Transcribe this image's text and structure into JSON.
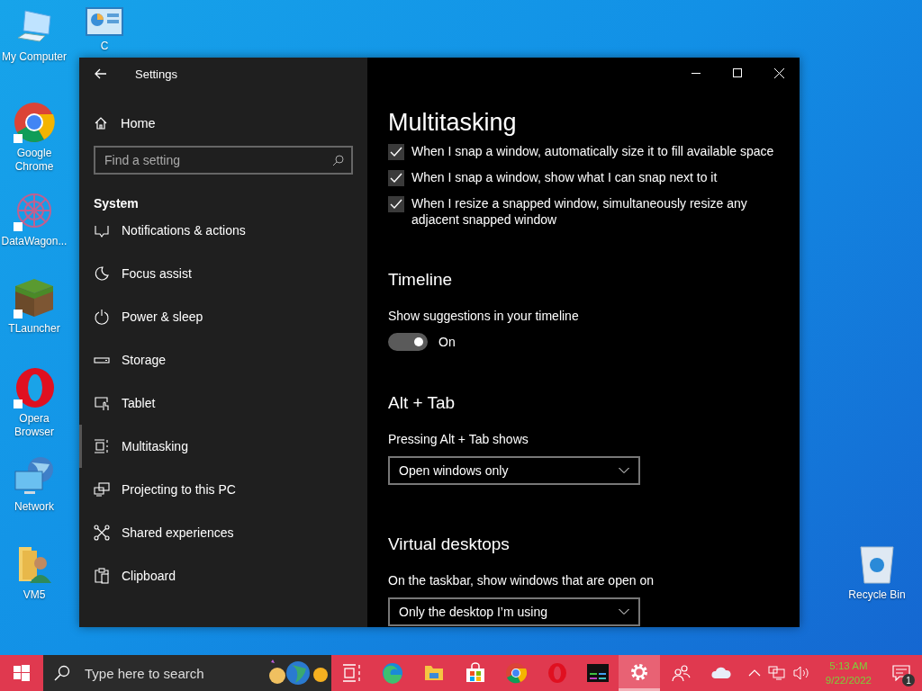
{
  "desktop_icons": [
    {
      "kind": "computer",
      "label": "My Computer"
    },
    {
      "kind": "panel",
      "label": "C"
    },
    {
      "kind": "chrome",
      "label": "Google Chrome"
    },
    {
      "kind": "datawagon",
      "label": "DataWagon..."
    },
    {
      "kind": "tlauncher",
      "label": "TLauncher"
    },
    {
      "kind": "opera",
      "label": "Opera Browser"
    },
    {
      "kind": "network",
      "label": "Network"
    },
    {
      "kind": "userfolder",
      "label": "VM5"
    },
    {
      "kind": "recycle",
      "label": "Recycle Bin"
    }
  ],
  "window": {
    "title": "Settings"
  },
  "sidebar": {
    "home": "Home",
    "search": {
      "placeholder": "Find a setting"
    },
    "section": "System",
    "items": [
      {
        "label": "Notifications & actions",
        "selected": false
      },
      {
        "label": "Focus assist",
        "selected": false
      },
      {
        "label": "Power & sleep",
        "selected": false
      },
      {
        "label": "Storage",
        "selected": false
      },
      {
        "label": "Tablet",
        "selected": false
      },
      {
        "label": "Multitasking",
        "selected": true
      },
      {
        "label": "Projecting to this PC",
        "selected": false
      },
      {
        "label": "Shared experiences",
        "selected": false
      },
      {
        "label": "Clipboard",
        "selected": false
      }
    ]
  },
  "page": {
    "title": "Multitasking",
    "snap_options": [
      {
        "label": "When I snap a window, automatically size it to fill available space",
        "checked": true
      },
      {
        "label": "When I snap a window, show what I can snap next to it",
        "checked": true
      },
      {
        "label": "When I resize a snapped window, simultaneously resize any adjacent snapped window",
        "checked": true
      }
    ],
    "timeline": {
      "heading": "Timeline",
      "label": "Show suggestions in your timeline",
      "on": true,
      "state": "On"
    },
    "alt_tab": {
      "heading": "Alt + Tab",
      "label": "Pressing Alt + Tab shows",
      "value": "Open windows only"
    },
    "virtual_desktops": {
      "heading": "Virtual desktops",
      "label": "On the taskbar, show windows that are open on",
      "value": "Only the desktop I’m using"
    }
  },
  "taskbar": {
    "search": {
      "placeholder": "Type here to search"
    },
    "apps": [
      {
        "kind": "taskview",
        "selected": false
      },
      {
        "kind": "edge",
        "selected": false
      },
      {
        "kind": "explorer",
        "selected": false
      },
      {
        "kind": "store",
        "selected": false
      },
      {
        "kind": "chrome",
        "selected": false
      },
      {
        "kind": "opera",
        "selected": false
      },
      {
        "kind": "console",
        "selected": false
      },
      {
        "kind": "settings",
        "selected": true
      },
      {
        "kind": "people",
        "selected": false
      },
      {
        "kind": "cloud",
        "selected": false
      }
    ],
    "time": "5:13 AM",
    "date": "9/22/2022",
    "notifications": "1"
  }
}
